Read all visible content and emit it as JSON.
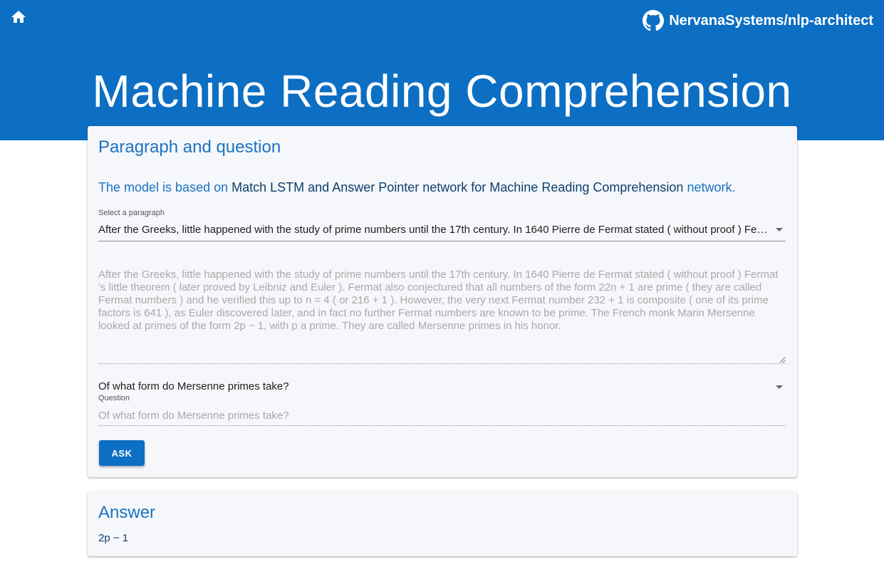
{
  "header": {
    "home_icon": "home-icon",
    "github_icon": "github-icon",
    "repo_label": "NervanaSystems/nlp-architect",
    "title": "Machine Reading Comprehension",
    "background_color": "#0c6fc3"
  },
  "qa_card": {
    "title": "Paragraph and question",
    "model_prefix": "The model is based on",
    "model_link": "Match LSTM and Answer Pointer network for Machine Reading Comprehension",
    "model_suffix": "network.",
    "select_label": "Select a paragraph",
    "select_value": "After the Greeks, little happened with the study of prime numbers until the 17th century. In 1640 Pierre de Fermat stated ( without proof ) Fermat 's little theorem ( later proved by Leibniz and Euler ). Fermat also conjectured that all numbers of the form 22n + 1 are prime ( they are called Fermat numbers ) and he verified this up to n = 4 ( or 216 + 1 ). However, the very next Fermat number 232 + 1 is composite ( one of its prime factors is 641 ), as Euler discovered later, and in fact no further Fermat numbers are known to be prime. The French monk Marin Mersenne looked at primes of the form 2p − 1, with p a prime. They are called Mersenne primes in his honor.",
    "paragraph_text": "After the Greeks, little happened with the study of prime numbers until the 17th century. In 1640 Pierre de Fermat stated ( without proof ) Fermat 's little theorem ( later proved by Leibniz and Euler ). Fermat also conjectured that all numbers of the form 22n + 1 are prime ( they are called Fermat numbers ) and he verified this up to n = 4 ( or 216 + 1 ). However, the very next Fermat number 232 + 1 is composite ( one of its prime factors is 641 ), as Euler discovered later, and in fact no further Fermat numbers are known to be prime. The French monk Marin Mersenne looked at primes of the form 2p − 1, with p a prime. They are called Mersenne primes in his honor.",
    "question_select_value": "Of what form do Mersenne primes take?",
    "question_label": "Question",
    "question_placeholder": "Of what form do Mersenne primes take?",
    "ask_label": "ASK"
  },
  "answer_card": {
    "title": "Answer",
    "answer": "2p − 1"
  }
}
